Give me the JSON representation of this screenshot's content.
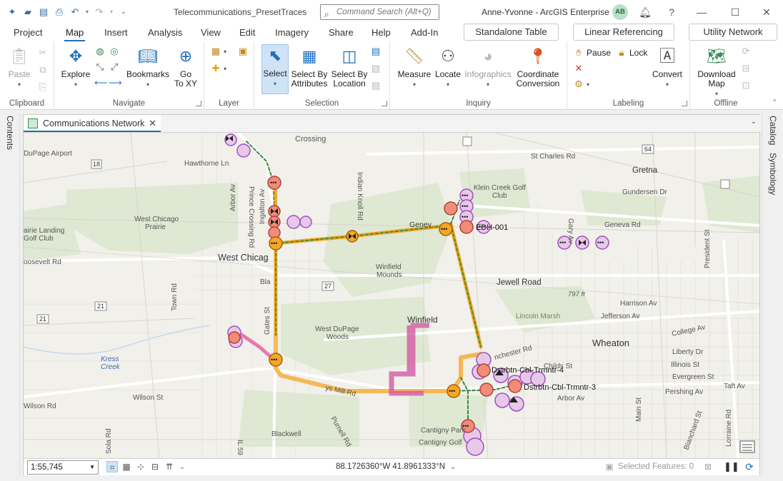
{
  "app": {
    "document_title": "Telecommunications_PresetTraces",
    "search_placeholder": "Command Search (Alt+Q)",
    "user": "Anne-Yvonne - ArcGIS Enterprise",
    "avatar": "AB"
  },
  "menu": {
    "tabs": [
      "Project",
      "Map",
      "Insert",
      "Analysis",
      "View",
      "Edit",
      "Imagery",
      "Share",
      "Help",
      "Add-In"
    ],
    "active": "Map",
    "contextual": [
      "Standalone Table",
      "Linear Referencing",
      "Utility Network"
    ]
  },
  "ribbon": {
    "clipboard": {
      "label": "Clipboard",
      "paste": "Paste"
    },
    "navigate": {
      "label": "Navigate",
      "explore": "Explore",
      "bookmarks": "Bookmarks",
      "goto1": "Go",
      "goto2": "To XY"
    },
    "layer": {
      "label": "Layer"
    },
    "selection": {
      "label": "Selection",
      "select": "Select",
      "by_attr1": "Select By",
      "by_attr2": "Attributes",
      "by_loc1": "Select By",
      "by_loc2": "Location"
    },
    "inquiry": {
      "label": "Inquiry",
      "measure": "Measure",
      "locate": "Locate",
      "infographics": "Infographics",
      "coord1": "Coordinate",
      "coord2": "Conversion"
    },
    "labeling": {
      "label": "Labeling",
      "pause": "Pause",
      "lock": "Lock",
      "convert": "Convert"
    },
    "offline": {
      "label": "Offline",
      "download1": "Download",
      "download2": "Map"
    }
  },
  "panes": {
    "left": "Contents",
    "right_1": "Catalog",
    "right_2": "Symbology"
  },
  "map": {
    "tab_title": "Communications Network",
    "scale": "1:55,745",
    "coordinates": "88.1726360°W 41.8961333°N",
    "selected_features": "Selected Features: 0",
    "labels": {
      "crossing": "Crossing",
      "dupage_airport": "DuPage Airport",
      "hawthorne": "Hawthorne Ln",
      "r18": "18",
      "r64": "64",
      "r27": "27",
      "r21": "21",
      "r21b": "21",
      "st_charles": "St Charles Rd",
      "gretna": "Gretna",
      "klein1": "Klein Creek Golf",
      "klein2": "Club",
      "gundersen": "Gundersen Dr",
      "prairie_landing1": "airie Landing",
      "prairie_landing2": "Golf Club",
      "wc_prairie1": "West Chicago",
      "wc_prairie2": "Prairie",
      "west_chicago": "West Chicag",
      "geneva": "Genev",
      "geneva_rd": "Geneva Rd",
      "edh": "EDH-001",
      "roosevelt": "oosevelt Rd",
      "winfield_mounds1": "Winfield",
      "winfield_mounds2": "Mounds",
      "jewell": "Jewell Road",
      "town_rd": "Town Rd",
      "harrison": "Harrison Av",
      "lincoln_marsh": "Lincoln Marsh",
      "jefferson": "Jefferson Av",
      "college": "College Av",
      "elev": "797 ft",
      "winfield": "Winfield",
      "wdp_woods1": "West DuPage",
      "wdp_woods2": "Woods",
      "wheaton": "Wheaton",
      "liberty": "Liberty Dr",
      "illinois": "Illinois St",
      "evergreen": "Evergreen St",
      "taft": "Taft Av",
      "pershing": "Pershing Av",
      "kress1": "Kress",
      "kress2": "Creek",
      "wilson": "Wilson St",
      "wilson_rd": "Wilson Rd",
      "dtr4": "Dstrbtn-Cbl-Trmntr-4",
      "dtr3": "Dstrbtn-Cbl-Trmntr-3",
      "manchester": "nchester Rd",
      "childs": "Childs St",
      "arbor": "Arbor Av",
      "main": "Main St",
      "cantigny_park": "Cantigny Park",
      "cantigny_golf": "Cantigny Golf",
      "blackwell": "Blackwell",
      "purnell": "Purnell Rd",
      "mill": "ys Mill Rd",
      "arbor_av": "Arbor Av",
      "ingalton": "Ingalton Av",
      "prince": "Prince Crossing Rd",
      "indian_knoll": "Indian Knoll Rd",
      "gates": "Gates St",
      "blair": "Bla",
      "gary": "Gary Av",
      "president": "President St",
      "blanchard": "Blanchard St",
      "lorraine": "Lorraine Rd",
      "is59": "IL 59",
      "sola": "Sola Rd"
    }
  }
}
